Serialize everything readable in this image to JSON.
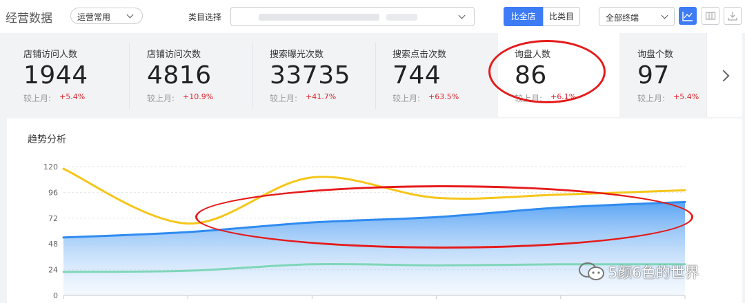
{
  "header": {
    "title": "经营数据",
    "scene_select": "运营常用",
    "category_label": "类目选择",
    "compare_store": "比全店",
    "compare_category": "比类目",
    "terminal_select": "全部终端"
  },
  "metrics": [
    {
      "label": "店铺访问人数",
      "value": "1944",
      "cmp_label": "较上月:",
      "change": "+5.4%"
    },
    {
      "label": "店铺访问次数",
      "value": "4816",
      "cmp_label": "较上月:",
      "change": "+10.9%"
    },
    {
      "label": "搜索曝光次数",
      "value": "33735",
      "cmp_label": "较上月:",
      "change": "+41.7%"
    },
    {
      "label": "搜索点击次数",
      "value": "744",
      "cmp_label": "较上月:",
      "change": "+63.5%"
    },
    {
      "label": "询盘人数",
      "value": "86",
      "cmp_label": "较上月:",
      "change": "+6.1%"
    },
    {
      "label": "询盘个数",
      "value": "97",
      "cmp_label": "较上月:",
      "change": "+5.4%"
    }
  ],
  "trend": {
    "title": "趋势分析"
  },
  "watermark": "5颜6色的世界",
  "colors": {
    "accent": "#3d7cf5",
    "increase": "#e0272f",
    "series_blue": "#2f8bf0",
    "series_yellow": "#f5c619",
    "series_green": "#7fd6b8",
    "annotation": "#e51a1a"
  },
  "chart_data": {
    "type": "area",
    "ylim": [
      0,
      120
    ],
    "yticks": [
      0,
      24,
      48,
      72,
      96,
      120
    ],
    "x": [
      0,
      1,
      2,
      3,
      4,
      5
    ],
    "series": [
      {
        "color": "#2f8bf0",
        "fill": true,
        "values": [
          54,
          59,
          68,
          73,
          82,
          87
        ]
      },
      {
        "color": "#f5c619",
        "fill": false,
        "values": [
          118,
          67,
          110,
          91,
          94,
          98
        ]
      },
      {
        "color": "#7fd6b8",
        "fill": false,
        "values": [
          22,
          23,
          29,
          28,
          29,
          29
        ]
      }
    ],
    "grid": true
  }
}
